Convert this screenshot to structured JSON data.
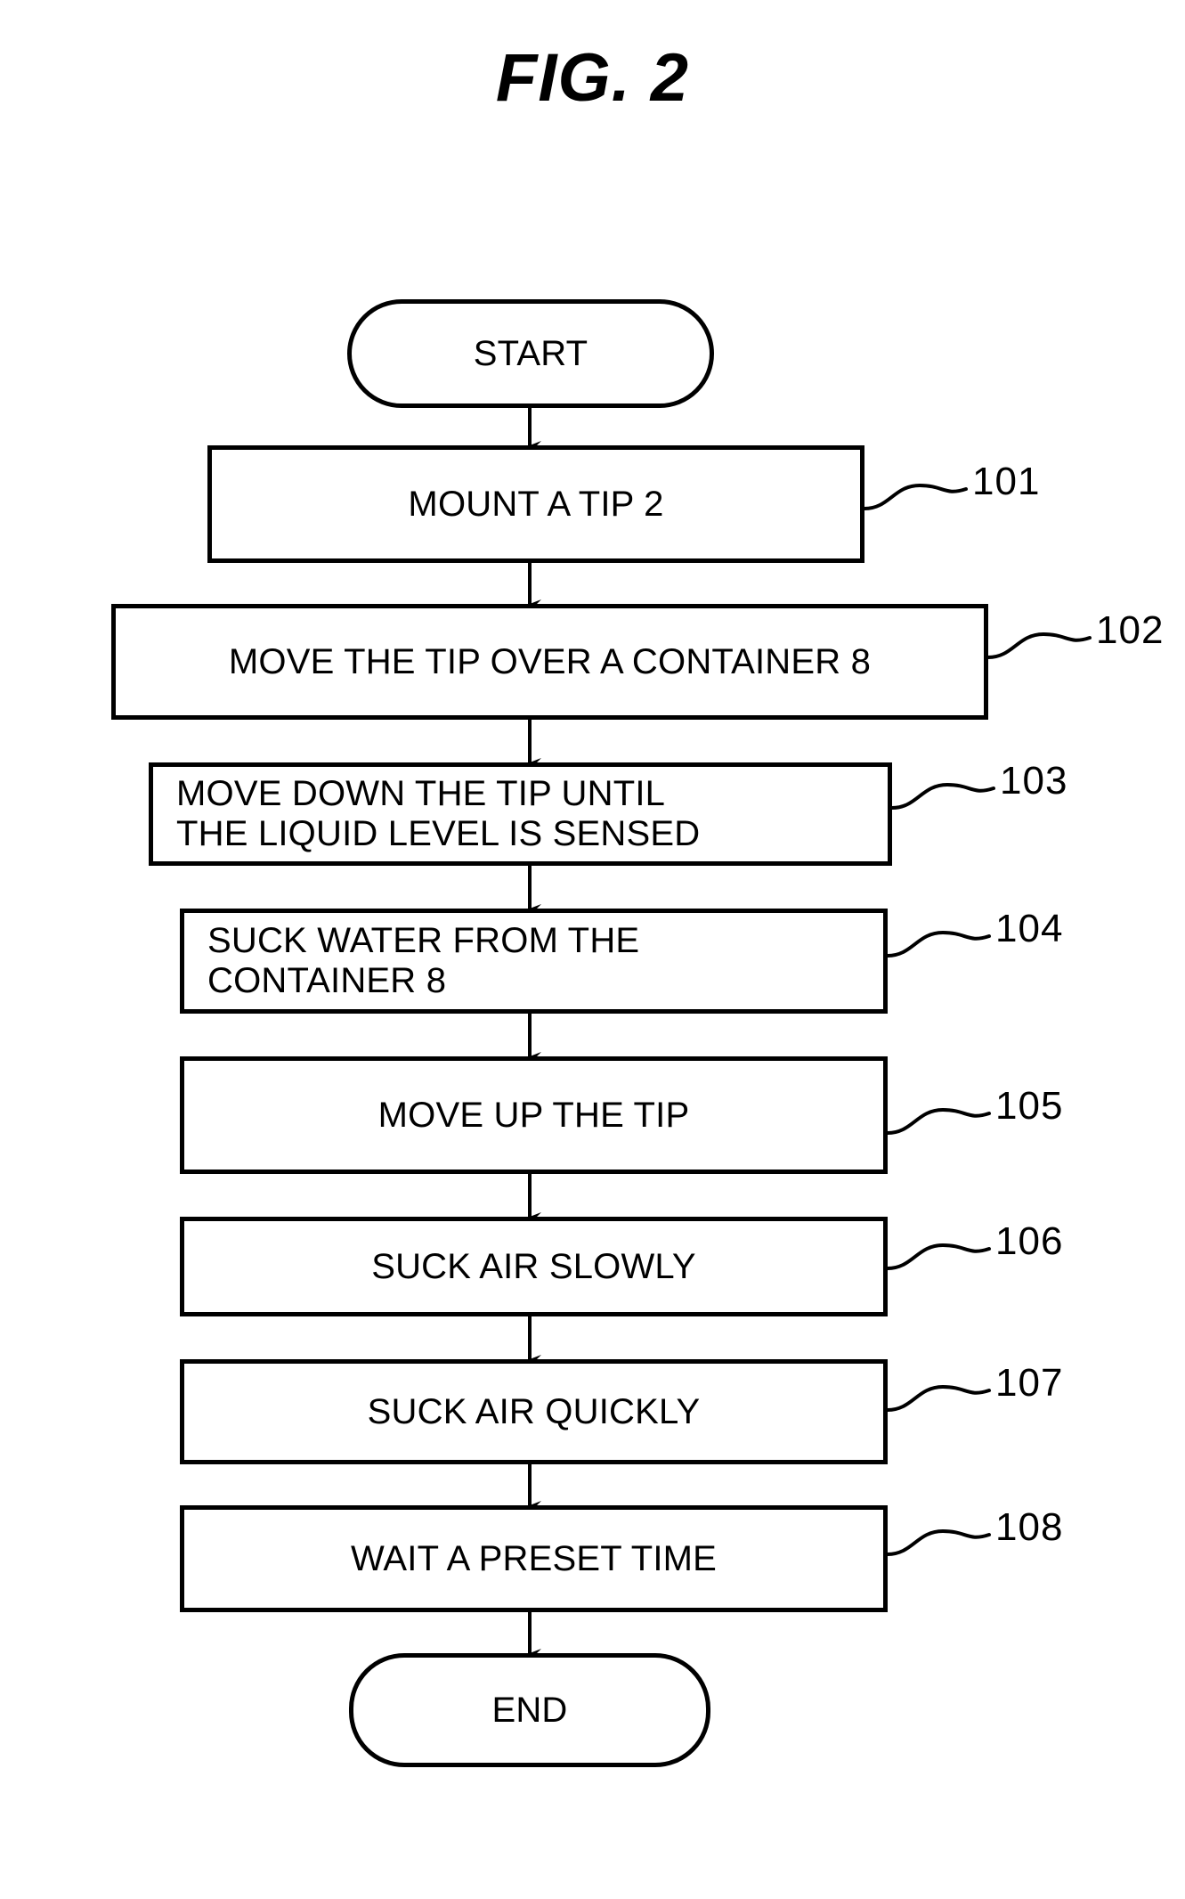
{
  "figure": {
    "title": "FIG. 2",
    "type": "flowchart"
  },
  "chart_data": {
    "type": "flowchart",
    "title": "FIG. 2",
    "orientation": "top-to-bottom",
    "nodes": [
      {
        "id": "start",
        "shape": "terminal",
        "label": "START",
        "ref": null
      },
      {
        "id": "s101",
        "shape": "process",
        "label": "MOUNT A TIP 2",
        "ref": "101"
      },
      {
        "id": "s102",
        "shape": "process",
        "label": "MOVE THE TIP OVER A CONTAINER 8",
        "ref": "102"
      },
      {
        "id": "s103",
        "shape": "process",
        "label": "MOVE DOWN THE TIP UNTIL\nTHE LIQUID LEVEL IS SENSED",
        "ref": "103"
      },
      {
        "id": "s104",
        "shape": "process",
        "label": "SUCK WATER FROM THE\nCONTAINER 8",
        "ref": "104"
      },
      {
        "id": "s105",
        "shape": "process",
        "label": "MOVE UP THE TIP",
        "ref": "105"
      },
      {
        "id": "s106",
        "shape": "process",
        "label": "SUCK AIR SLOWLY",
        "ref": "106"
      },
      {
        "id": "s107",
        "shape": "process",
        "label": "SUCK AIR QUICKLY",
        "ref": "107"
      },
      {
        "id": "s108",
        "shape": "process",
        "label": "WAIT A PRESET TIME",
        "ref": "108"
      },
      {
        "id": "end",
        "shape": "terminal",
        "label": "END",
        "ref": null
      }
    ],
    "edges": [
      {
        "from": "start",
        "to": "s101",
        "arrow": true
      },
      {
        "from": "s101",
        "to": "s102",
        "arrow": true
      },
      {
        "from": "s102",
        "to": "s103",
        "arrow": true
      },
      {
        "from": "s103",
        "to": "s104",
        "arrow": true
      },
      {
        "from": "s104",
        "to": "s105",
        "arrow": true
      },
      {
        "from": "s105",
        "to": "s106",
        "arrow": true
      },
      {
        "from": "s106",
        "to": "s107",
        "arrow": true
      },
      {
        "from": "s107",
        "to": "s108",
        "arrow": true
      },
      {
        "from": "s108",
        "to": "end",
        "arrow": true
      }
    ],
    "reference_numerals": [
      "101",
      "102",
      "103",
      "104",
      "105",
      "106",
      "107",
      "108"
    ],
    "colors": {
      "stroke": "#000000",
      "fill": "#ffffff",
      "text": "#000000"
    }
  },
  "nodes": {
    "start": {
      "label": "START"
    },
    "s101": {
      "label": "MOUNT A TIP 2",
      "ref": "101"
    },
    "s102": {
      "label": "MOVE THE TIP OVER A CONTAINER 8",
      "ref": "102"
    },
    "s103": {
      "label": "MOVE DOWN THE TIP UNTIL\nTHE LIQUID LEVEL IS SENSED",
      "ref": "103"
    },
    "s104": {
      "label": "SUCK WATER FROM THE\nCONTAINER 8",
      "ref": "104"
    },
    "s105": {
      "label": "MOVE UP THE TIP",
      "ref": "105"
    },
    "s106": {
      "label": "SUCK AIR SLOWLY",
      "ref": "106"
    },
    "s107": {
      "label": "SUCK AIR QUICKLY",
      "ref": "107"
    },
    "s108": {
      "label": "WAIT A PRESET TIME",
      "ref": "108"
    },
    "end": {
      "label": "END"
    }
  }
}
